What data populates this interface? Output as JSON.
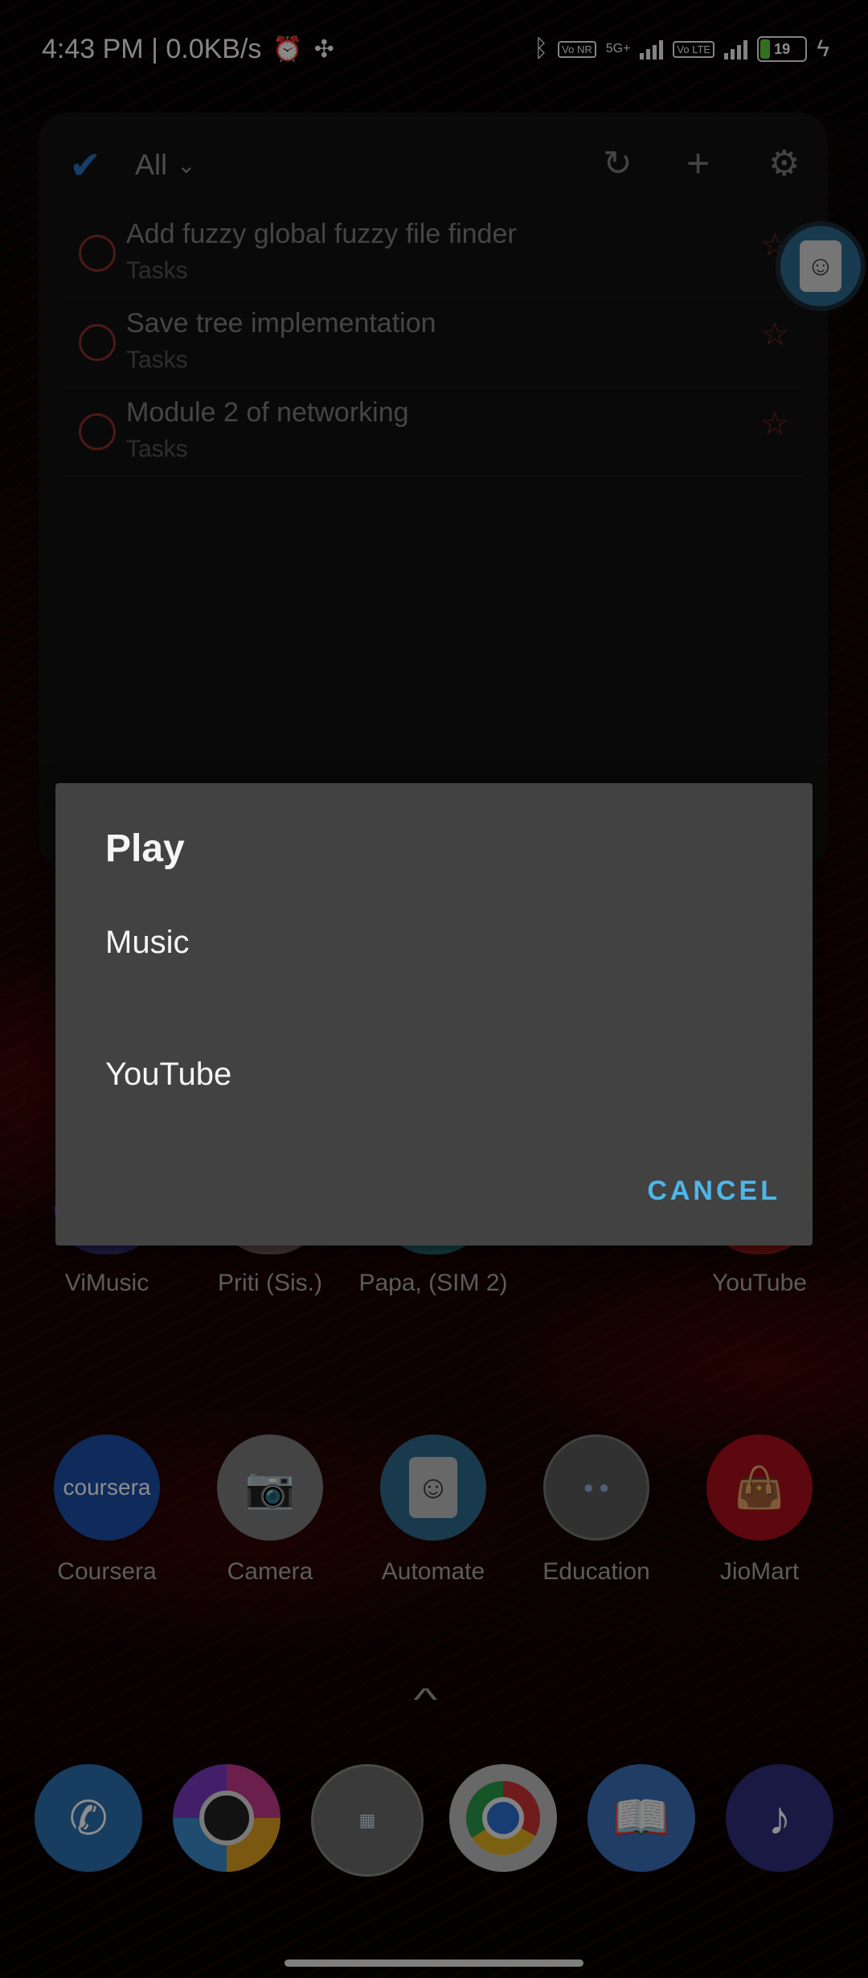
{
  "status": {
    "time_speed": "4:43 PM | 0.0KB/s",
    "battery": "19",
    "net_5g": "5G+",
    "volte1": "Vo NR",
    "volte2": "Vo LTE"
  },
  "widget": {
    "filter": "All",
    "tasks": [
      {
        "title": "Add fuzzy global fuzzy file finder",
        "list": "Tasks"
      },
      {
        "title": "Save tree implementation",
        "list": "Tasks"
      },
      {
        "title": "Module 2 of networking",
        "list": "Tasks"
      }
    ]
  },
  "home": {
    "row1": [
      {
        "label": "ViMusic"
      },
      {
        "label": "Priti (Sis.)"
      },
      {
        "label": "Papa, (SIM 2)"
      },
      {
        "label": "YouTube"
      }
    ],
    "row2": [
      {
        "label": "Coursera",
        "icon_text": "coursera"
      },
      {
        "label": "Camera"
      },
      {
        "label": "Automate"
      },
      {
        "label": "Education"
      },
      {
        "label": "JioMart"
      }
    ]
  },
  "dialog": {
    "title": "Play",
    "options": [
      "Music",
      "YouTube"
    ],
    "cancel": "CANCEL"
  },
  "colors": {
    "accent": "#4fb6ea",
    "dialog_bg": "#424242",
    "task_circle": "#8a2f2a"
  }
}
